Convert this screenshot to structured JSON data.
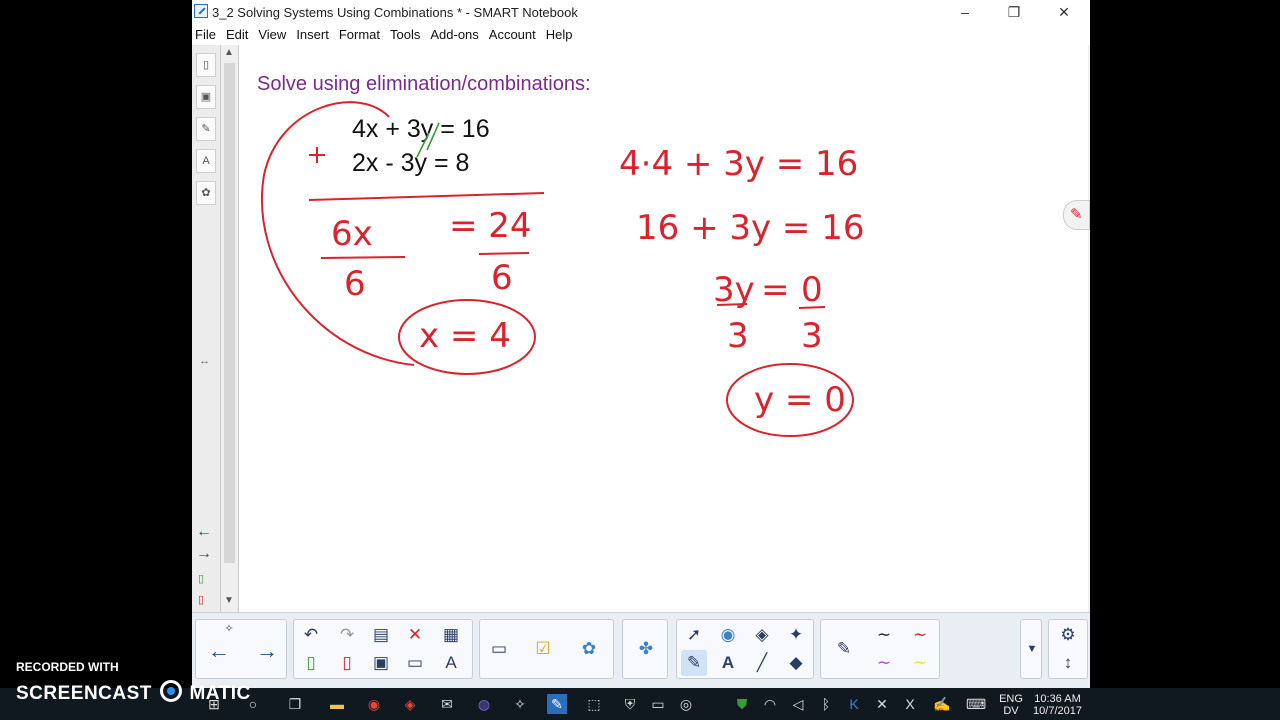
{
  "window": {
    "title": "3_2 Solving Systems Using Combinations * - SMART Notebook",
    "minimize": "–",
    "restore": "❐",
    "close": "✕"
  },
  "menu": [
    "File",
    "Edit",
    "View",
    "Insert",
    "Format",
    "Tools",
    "Add-ons",
    "Account",
    "Help"
  ],
  "sidebar": {
    "tabs": [
      "page-sorter-icon",
      "gallery-icon",
      "attachments-icon",
      "properties-icon",
      "addons-icon"
    ],
    "collapse": "↔"
  },
  "page": {
    "heading": "Solve using elimination/combinations:",
    "eq1": "4x + 3y = 16",
    "eq2": "2x - 3y = 8",
    "plus": "+",
    "hw_sum_left": "6x",
    "hw_sum_right": "= 24",
    "hw_div_left": "6",
    "hw_div_right": "6",
    "hw_x": "x = 4",
    "hw_sub1": "4·4 + 3y = 16",
    "hw_sub2": "16 + 3y = 16",
    "hw_sub3_left": "3y",
    "hw_sub3_eq": "=",
    "hw_sub3_right": "0",
    "hw_div3_left": "3",
    "hw_div3_right": "3",
    "hw_y": "y = 0"
  },
  "toolbar": {
    "buttons": [
      "previous-page",
      "next-page",
      "undo",
      "redo",
      "paste",
      "delete",
      "table",
      "screen-shade",
      "capture",
      "response",
      "addons",
      "select",
      "shapes",
      "fill",
      "magic-pen",
      "pen",
      "text",
      "line",
      "eraser",
      "pen-styles",
      "more",
      "settings",
      "move-toolbar"
    ]
  },
  "taskbar": {
    "time": "10:36 AM",
    "date": "10/7/2017",
    "lang1": "ENG",
    "lang2": "DV"
  },
  "overlay": {
    "recorded": "RECORDED WITH",
    "brand_left": "SCREENCAST",
    "brand_right": "MATIC"
  },
  "colors": {
    "ink_red": "#d9232d",
    "heading_purple": "#7a2a8e",
    "check_green": "#3a9a3a"
  }
}
